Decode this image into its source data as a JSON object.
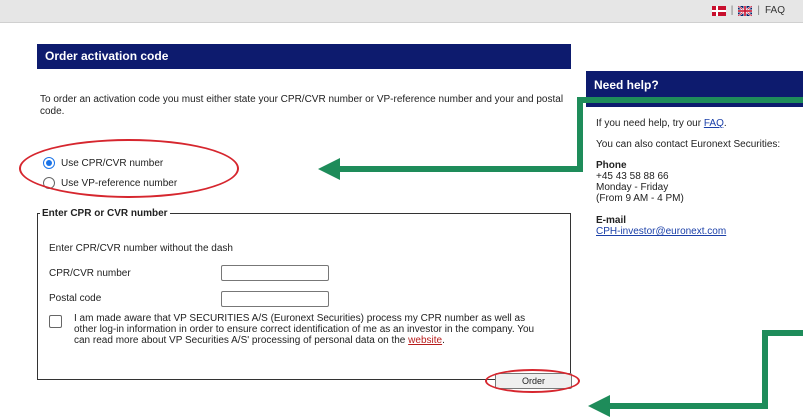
{
  "topbar": {
    "lang_dk_icon": "flag-denmark",
    "lang_uk_icon": "flag-uk",
    "separator": "|",
    "faq": "FAQ"
  },
  "main": {
    "title": "Order activation code",
    "intro": "To order an activation code you must either state your CPR/CVR number or VP-reference number and your and postal code.",
    "radio_options": [
      {
        "label": "Use CPR/CVR number",
        "checked": true
      },
      {
        "label": "Use VP-reference number",
        "checked": false
      }
    ],
    "fieldset_legend": "Enter CPR or CVR number",
    "field_desc": "Enter CPR/CVR number without the dash",
    "cpr_label": "CPR/CVR number",
    "cpr_value": "",
    "postal_label": "Postal code",
    "postal_value": "",
    "consent_text": "I am made aware that VP SECURITIES A/S (Euronext Securities) process my CPR number as well as other log-in information in order to ensure correct identification of me as an investor in the company. You can read more about VP Securities A/S' processing of personal data on the",
    "consent_link": "website",
    "consent_end": ".",
    "order_button": "Order"
  },
  "help": {
    "title": "Need help?",
    "line1": "If you need help, try our",
    "faq_link": "FAQ",
    "line1_end": ".",
    "line2": "You can also contact Euronext Securities:",
    "phone_title": "Phone",
    "phone_number": "+45 43 58 88 66",
    "phone_days": "Monday - Friday",
    "phone_hours": "(From 9 AM - 4 PM)",
    "email_title": "E-mail",
    "email": "CPH-investor@euronext.com"
  },
  "colors": {
    "header_navy": "#0d1b6e",
    "annotation_red": "#d6262e",
    "arrow_green": "#1e8c5a",
    "link_red": "#b71c1c"
  }
}
